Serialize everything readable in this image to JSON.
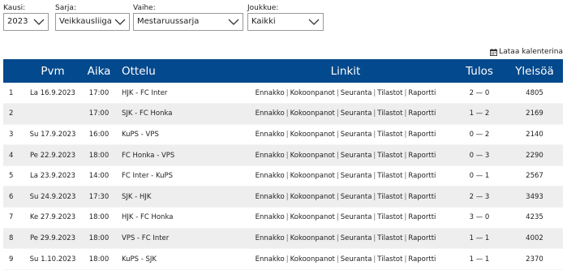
{
  "filters": [
    {
      "label": "Kausi:",
      "value": "2023"
    },
    {
      "label": "Sarja:",
      "value": "Veikkausliiga"
    },
    {
      "label": "Vaihe:",
      "value": "Mestaruussarja"
    },
    {
      "label": "Joukkue:",
      "value": "Kaikki"
    }
  ],
  "calendar_link": {
    "label": "Lataa kalenterina",
    "icon": "calendar-icon"
  },
  "table": {
    "headers": {
      "num": "",
      "date": "Pvm",
      "time": "Aika",
      "match": "Ottelu",
      "links": "Linkit",
      "result": "Tulos",
      "attendance": "Yleisöä"
    },
    "link_labels": [
      "Ennakko",
      "Kokoonpanot",
      "Seuranta",
      "Tilastot",
      "Raportti"
    ],
    "link_separator": "|",
    "rows": [
      {
        "num": "1",
        "date": "La 16.9.2023",
        "time": "17:00",
        "match": "HJK - FC Inter",
        "result": "2 — 0",
        "attendance": "4805"
      },
      {
        "num": "2",
        "date": "",
        "time": "17:00",
        "match": "SJK - FC Honka",
        "result": "1 — 2",
        "attendance": "2169"
      },
      {
        "num": "3",
        "date": "Su 17.9.2023",
        "time": "16:00",
        "match": "KuPS - VPS",
        "result": "0 — 2",
        "attendance": "2140"
      },
      {
        "num": "4",
        "date": "Pe 22.9.2023",
        "time": "18:00",
        "match": "FC Honka - VPS",
        "result": "0 — 3",
        "attendance": "2290"
      },
      {
        "num": "5",
        "date": "La 23.9.2023",
        "time": "14:00",
        "match": "FC Inter - KuPS",
        "result": "0 — 1",
        "attendance": "2567"
      },
      {
        "num": "6",
        "date": "Su 24.9.2023",
        "time": "17:30",
        "match": "SJK - HJK",
        "result": "2 — 3",
        "attendance": "3493"
      },
      {
        "num": "7",
        "date": "Ke 27.9.2023",
        "time": "18:00",
        "match": "HJK - FC Honka",
        "result": "3 — 0",
        "attendance": "4235"
      },
      {
        "num": "8",
        "date": "Pe 29.9.2023",
        "time": "18:00",
        "match": "VPS - FC Inter",
        "result": "1 — 1",
        "attendance": "4002"
      },
      {
        "num": "9",
        "date": "Su 1.10.2023",
        "time": "18:00",
        "match": "KuPS - SJK",
        "result": "1 — 1",
        "attendance": "2370"
      }
    ]
  },
  "colors": {
    "header_bg": "#03498d",
    "header_text": "#ffffff",
    "row_alt": "#eeeeee"
  }
}
